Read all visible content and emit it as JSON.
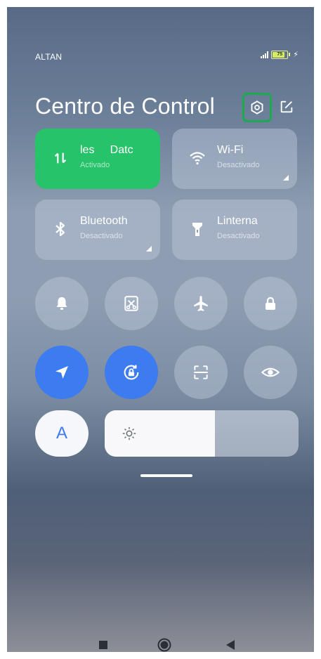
{
  "status_bar": {
    "carrier": "ALTAN",
    "battery_level": "75",
    "signal_icon": "signal-icon",
    "charging_icon": "charging-bolt-icon"
  },
  "header": {
    "title": "Centro de Control",
    "settings_icon": "settings-gear-icon",
    "edit_icon": "edit-icon"
  },
  "tiles": [
    {
      "name": "les     Datc",
      "status": "Activado",
      "icon": "mobile-data-icon",
      "active": true
    },
    {
      "name": "Wi-Fi",
      "status": "Desactivado",
      "icon": "wifi-icon",
      "active": false
    },
    {
      "name": "Bluetooth",
      "status": "Desactivado",
      "icon": "bluetooth-icon",
      "active": false
    },
    {
      "name": "Linterna",
      "status": "Desactivado",
      "icon": "flashlight-icon",
      "active": false
    }
  ],
  "toggles_row1": [
    "bell-icon",
    "screenshot-icon",
    "airplane-icon",
    "lock-icon"
  ],
  "toggles_row2": [
    "location-icon",
    "rotation-lock-icon",
    "scanner-icon",
    "eye-icon"
  ],
  "brightness": {
    "auto_label": "A",
    "level_percent": 57,
    "icon": "sun-icon"
  },
  "colors": {
    "active_green": "#27c36a",
    "active_blue": "#3d7bf0",
    "highlight_border": "#1ea84f"
  },
  "nav_bar": [
    "recents-square-icon",
    "home-circle-icon",
    "back-triangle-icon"
  ]
}
